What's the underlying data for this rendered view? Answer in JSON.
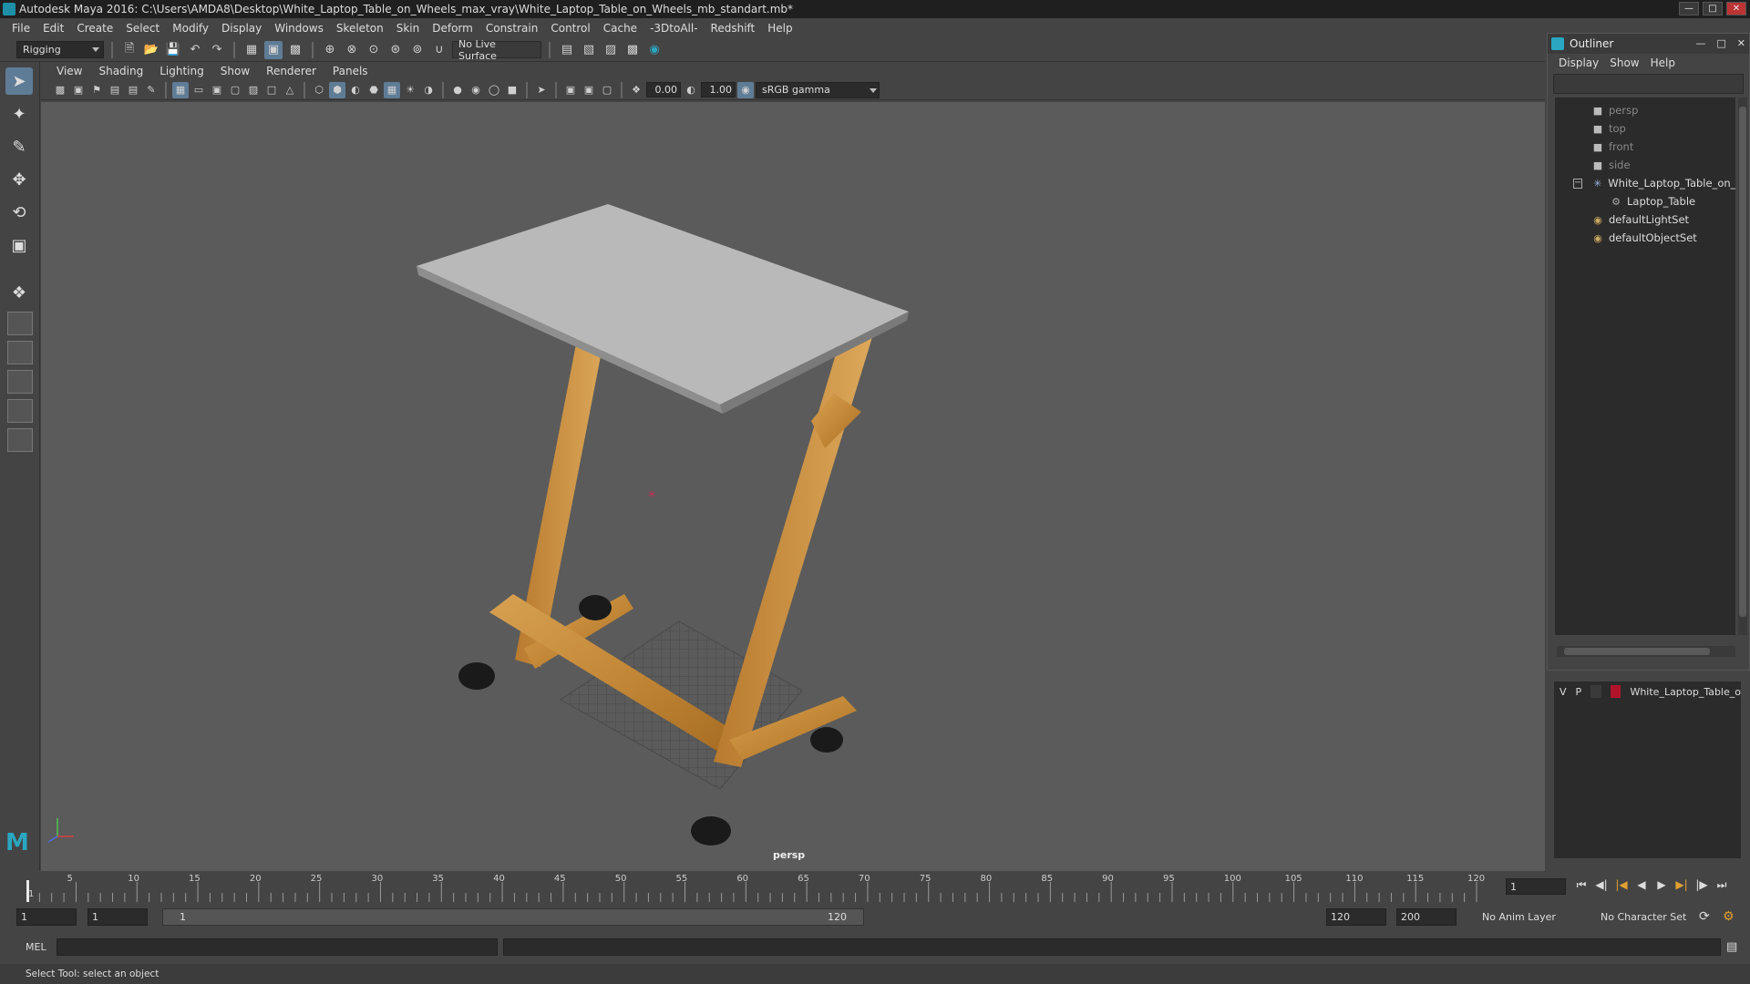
{
  "window": {
    "title": "Autodesk Maya 2016: C:\\Users\\AMDA8\\Desktop\\White_Laptop_Table_on_Wheels_max_vray\\White_Laptop_Table_on_Wheels_mb_standart.mb*"
  },
  "menubar": [
    "File",
    "Edit",
    "Create",
    "Select",
    "Modify",
    "Display",
    "Windows",
    "Skeleton",
    "Skin",
    "Deform",
    "Constrain",
    "Control",
    "Cache",
    "-3DtoAll-",
    "Redshift",
    "Help"
  ],
  "shelf": {
    "mode": "Rigging",
    "live_surface": "No Live Surface"
  },
  "panel": {
    "menus": [
      "View",
      "Shading",
      "Lighting",
      "Show",
      "Renderer",
      "Panels"
    ],
    "exposure": "0.00",
    "gamma_value": "1.00",
    "color_space": "sRGB gamma",
    "camera_label": "persp"
  },
  "outliner": {
    "title": "Outliner",
    "menus": [
      "Display",
      "Show",
      "Help"
    ],
    "nodes": [
      {
        "label": "persp",
        "type": "camera"
      },
      {
        "label": "top",
        "type": "camera"
      },
      {
        "label": "front",
        "type": "camera"
      },
      {
        "label": "side",
        "type": "camera"
      },
      {
        "label": "White_Laptop_Table_on_W",
        "type": "group"
      },
      {
        "label": "Laptop_Table",
        "type": "mesh"
      },
      {
        "label": "defaultLightSet",
        "type": "set"
      },
      {
        "label": "defaultObjectSet",
        "type": "set"
      }
    ]
  },
  "layers": {
    "v": "V",
    "p": "P",
    "name": "White_Laptop_Table_o",
    "color": "#b0142a"
  },
  "timeline": {
    "ticks": [
      "1",
      "5",
      "10",
      "15",
      "20",
      "25",
      "30",
      "35",
      "40",
      "45",
      "50",
      "55",
      "60",
      "65",
      "70",
      "75",
      "80",
      "85",
      "90",
      "95",
      "100",
      "105",
      "110",
      "115",
      "120"
    ],
    "current_frame": "1"
  },
  "range": {
    "start": "1",
    "anim_start": "1",
    "slider_start": "1",
    "slider_end": "120",
    "end": "120",
    "anim_end": "200",
    "anim_layer": "No Anim Layer",
    "character_set": "No Character Set"
  },
  "command": {
    "lang": "MEL"
  },
  "help": {
    "text": "Select Tool: select an object"
  }
}
